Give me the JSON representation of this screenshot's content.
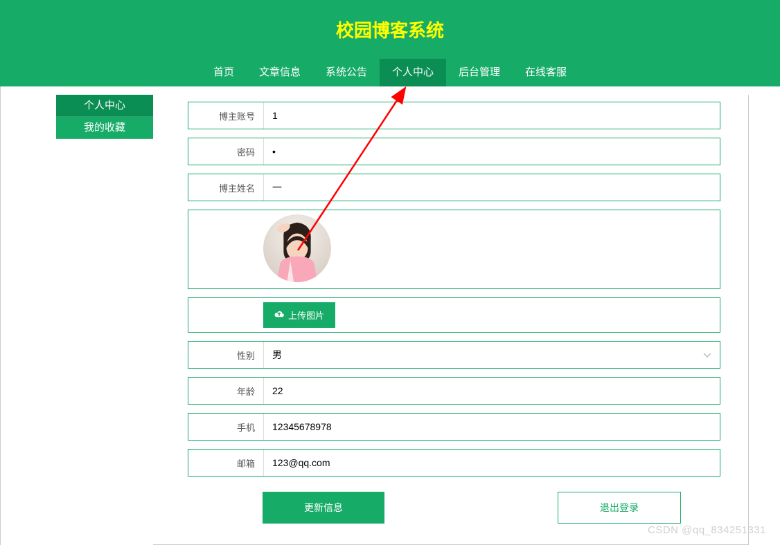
{
  "header": {
    "title": "校园博客系统"
  },
  "nav": {
    "items": [
      {
        "label": "首页"
      },
      {
        "label": "文章信息"
      },
      {
        "label": "系统公告"
      },
      {
        "label": "个人中心",
        "active": true
      },
      {
        "label": "后台管理"
      },
      {
        "label": "在线客服"
      }
    ]
  },
  "sidebar": {
    "items": [
      {
        "label": "个人中心",
        "active": true
      },
      {
        "label": "我的收藏"
      }
    ]
  },
  "form": {
    "account": {
      "label": "博主账号",
      "value": "1"
    },
    "password": {
      "label": "密码",
      "value": "•"
    },
    "name": {
      "label": "博主姓名",
      "value": "一"
    },
    "upload_label": "上传图片",
    "gender": {
      "label": "性别",
      "value": "男"
    },
    "age": {
      "label": "年龄",
      "value": "22"
    },
    "phone": {
      "label": "手机",
      "value": "12345678978"
    },
    "email": {
      "label": "邮箱",
      "value": "123@qq.com"
    }
  },
  "buttons": {
    "update": "更新信息",
    "logout": "退出登录"
  },
  "watermark": "CSDN @qq_834251331"
}
